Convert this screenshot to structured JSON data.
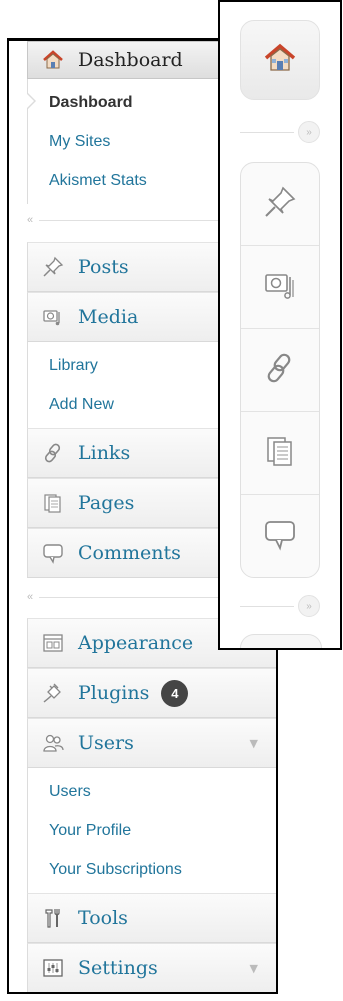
{
  "expanded_menu": {
    "dashboard": {
      "label": "Dashboard",
      "submenu": [
        "Dashboard",
        "My Sites",
        "Akismet Stats"
      ]
    },
    "separator_collapse": "«",
    "content_items": {
      "posts": "Posts",
      "media": "Media",
      "media_submenu": [
        "Library",
        "Add New"
      ],
      "links": "Links",
      "pages": "Pages",
      "comments": "Comments"
    },
    "separator_collapse_2": "«",
    "admin_items": {
      "appearance": "Appearance",
      "plugins": "Plugins",
      "plugins_badge": "4",
      "users": "Users",
      "users_submenu": [
        "Users",
        "Your Profile",
        "Your Subscriptions"
      ],
      "tools": "Tools",
      "settings": "Settings"
    },
    "arrow_glyph": "▼"
  },
  "collapsed_menu": {
    "expand_glyph": "»"
  },
  "colors": {
    "link": "#21759b",
    "icon_gray": "#8a8a8a",
    "badge_bg": "#454545",
    "home_roof": "#c9452a"
  }
}
